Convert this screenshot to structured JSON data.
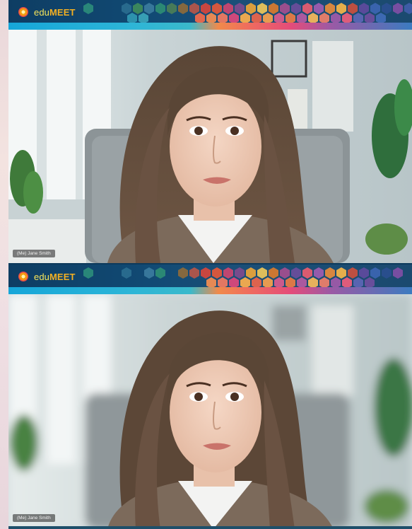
{
  "app": {
    "name_prefix": "edu",
    "name_suffix": "MEET"
  },
  "tiles": [
    {
      "participant_label": "(Me) Jane Smith",
      "background": "sharp office"
    },
    {
      "participant_label": "(Me) Jane Smith",
      "background": "blurred office"
    }
  ],
  "colors": {
    "header": "#114a74",
    "brand_yellow": "#f7e45a",
    "brand_orange": "#f3b023",
    "logo_red": "#e5484d"
  },
  "icons": [
    "edumeet-logo-icon"
  ]
}
